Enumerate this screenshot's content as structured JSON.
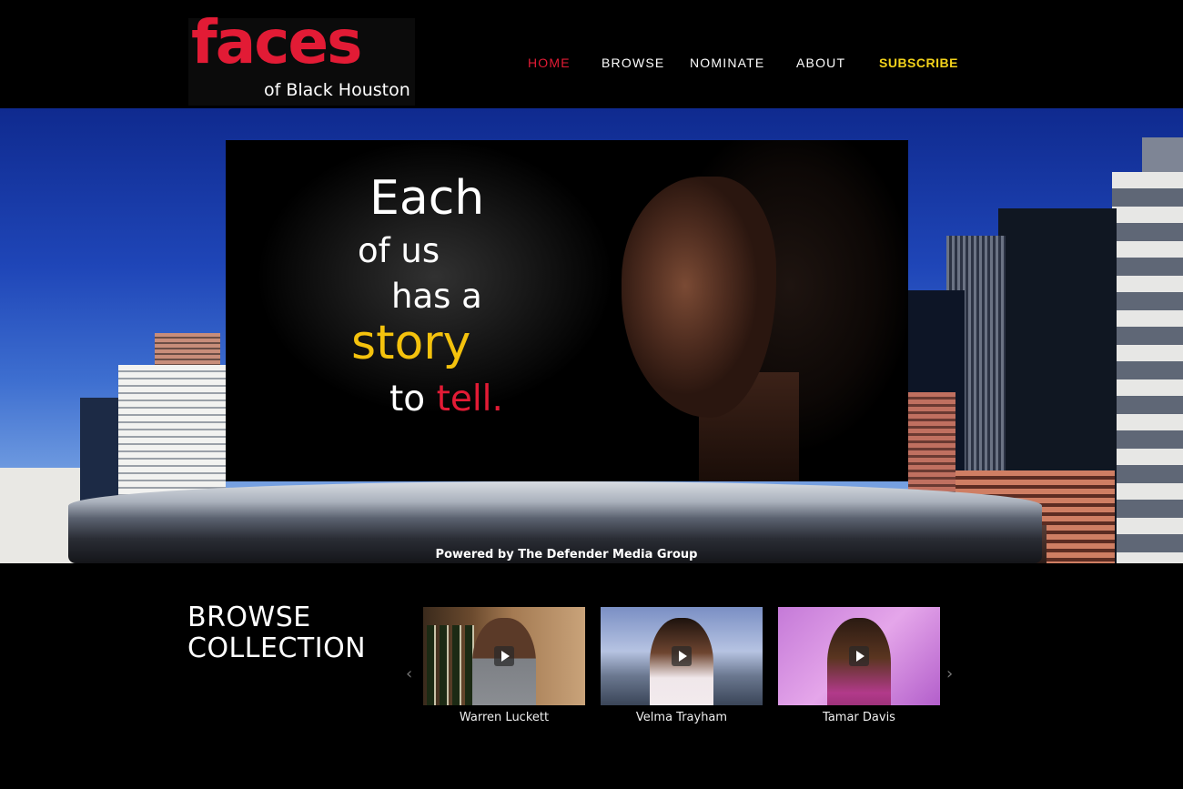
{
  "brand": {
    "logo_main": "faces",
    "logo_sub": "of Black Houston",
    "accent_red": "#e21b35",
    "accent_yellow": "#f2d21b"
  },
  "nav": {
    "items": [
      {
        "label": "HOME",
        "active": true
      },
      {
        "label": "BROWSE"
      },
      {
        "label": "NOMINATE"
      },
      {
        "label": "ABOUT"
      },
      {
        "label": "SUBSCRIBE"
      }
    ]
  },
  "hero": {
    "line1": "Each",
    "line2": "of us",
    "line3": "has a",
    "line4": "story",
    "line5_a": "to",
    "line5_b": "tell.",
    "powered_by": "Powered by The Defender Media Group"
  },
  "browse": {
    "title_line1": "BROWSE",
    "title_line2": "COLLECTION",
    "prev_icon": "chevron-left-icon",
    "next_icon": "chevron-right-icon",
    "cards": [
      {
        "name": "Warren Luckett"
      },
      {
        "name": "Velma Trayham"
      },
      {
        "name": "Tamar Davis"
      }
    ]
  }
}
